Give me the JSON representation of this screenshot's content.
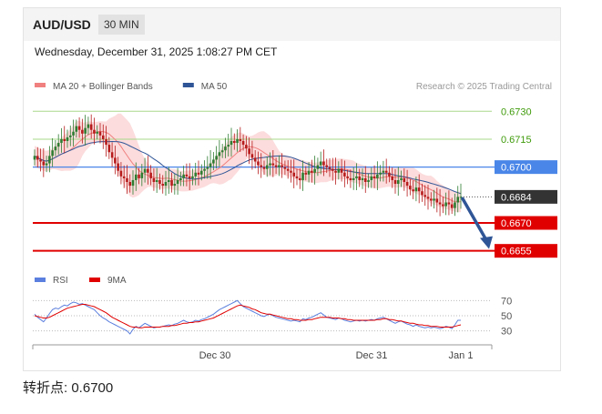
{
  "header": {
    "pair": "AUD/USD",
    "timeframe": "30 MIN",
    "datetime": "Wednesday, December 31, 2025 1:08:27 PM CET"
  },
  "footer": {
    "pivot_label": "转折点:",
    "pivot_value": "0.6700"
  },
  "colors": {
    "ma20": "#f08080",
    "ma50": "#2f5597",
    "bands_fill": "#fbd6d6",
    "pivot_line": "#4a86e8",
    "support_line": "#e00000",
    "resistance_line": "#a9d98a",
    "resistance_text": "#3f9b0b",
    "current_tag": "#333333",
    "arrow": "#2f5597",
    "candle_up": "#2e7d32",
    "candle_down": "#b71c1c",
    "rsi": "#5b7fde",
    "rsi_ma": "#e00000"
  },
  "chart_data": [
    {
      "type": "candlestick",
      "legend": [
        {
          "name": "MA 20 + Bollinger Bands",
          "color": "#f08080"
        },
        {
          "name": "MA 50",
          "color": "#2f5597"
        }
      ],
      "source_note": "Research © 2025 Trading Central",
      "ylim": [
        0.6648,
        0.6736
      ],
      "x_ticks": [
        "Dec 30",
        "Dec 31",
        "Jan 1"
      ],
      "levels": [
        {
          "value": 0.673,
          "label": "0.6730",
          "kind": "resistance"
        },
        {
          "value": 0.6715,
          "label": "0.6715",
          "kind": "resistance"
        },
        {
          "value": 0.67,
          "label": "0.6700",
          "kind": "pivot"
        },
        {
          "value": 0.6684,
          "label": "0.6684",
          "kind": "current"
        },
        {
          "value": 0.667,
          "label": "0.6670",
          "kind": "support"
        },
        {
          "value": 0.6655,
          "label": "0.6655",
          "kind": "support"
        }
      ],
      "close": [
        0.6706,
        0.6704,
        0.6703,
        0.6701,
        0.6702,
        0.6706,
        0.6709,
        0.6711,
        0.6713,
        0.6715,
        0.6714,
        0.6716,
        0.6717,
        0.6719,
        0.6722,
        0.672,
        0.6718,
        0.6721,
        0.6723,
        0.672,
        0.6718,
        0.6719,
        0.6717,
        0.6715,
        0.6712,
        0.6708,
        0.6705,
        0.6702,
        0.6698,
        0.6695,
        0.6694,
        0.6692,
        0.669,
        0.6693,
        0.6696,
        0.6694,
        0.6697,
        0.6699,
        0.6697,
        0.6694,
        0.6692,
        0.6693,
        0.6691,
        0.669,
        0.6692,
        0.6693,
        0.669,
        0.6691,
        0.6693,
        0.6694,
        0.6696,
        0.6695,
        0.6694,
        0.6695,
        0.6697,
        0.6696,
        0.6698,
        0.6699,
        0.67,
        0.6702,
        0.6704,
        0.6706,
        0.6708,
        0.6709,
        0.6711,
        0.6712,
        0.6714,
        0.6713,
        0.6715,
        0.6714,
        0.6712,
        0.671,
        0.6707,
        0.6705,
        0.6703,
        0.6701,
        0.67,
        0.6699,
        0.6701,
        0.6702,
        0.6701,
        0.67,
        0.6701,
        0.67,
        0.6699,
        0.6698,
        0.6697,
        0.6695,
        0.6694,
        0.6693,
        0.6697,
        0.6696,
        0.6698,
        0.6697,
        0.6699,
        0.6701,
        0.6703,
        0.6701,
        0.67,
        0.6699,
        0.6698,
        0.6697,
        0.6699,
        0.6697,
        0.6695,
        0.6694,
        0.6693,
        0.6694,
        0.6695,
        0.6693,
        0.6694,
        0.6692,
        0.6693,
        0.6695,
        0.6694,
        0.6696,
        0.6697,
        0.6698,
        0.6697,
        0.6695,
        0.6693,
        0.6691,
        0.6693,
        0.6694,
        0.6692,
        0.669,
        0.6688,
        0.6687,
        0.6689,
        0.6687,
        0.6685,
        0.6684,
        0.6683,
        0.6682,
        0.6683,
        0.6681,
        0.668,
        0.6679,
        0.6681,
        0.668,
        0.6678,
        0.6681,
        0.6684,
        0.6684
      ],
      "projection": {
        "from": 0.6684,
        "to": 0.6655
      }
    },
    {
      "type": "line",
      "legend": [
        {
          "name": "RSI",
          "color": "#5b7fde"
        },
        {
          "name": "9MA",
          "color": "#e00000"
        }
      ],
      "ylim": [
        20,
        80
      ],
      "y_ticks": [
        70,
        50,
        30
      ],
      "series": [
        {
          "name": "RSI",
          "values": [
            52,
            48,
            45,
            42,
            47,
            53,
            58,
            60,
            59,
            62,
            64,
            63,
            66,
            68,
            67,
            65,
            66,
            64,
            62,
            60,
            58,
            54,
            50,
            47,
            45,
            42,
            40,
            38,
            36,
            34,
            32,
            30,
            26,
            32,
            36,
            34,
            37,
            40,
            38,
            36,
            34,
            35,
            35,
            36,
            37,
            38,
            37,
            39,
            40,
            42,
            44,
            42,
            41,
            42,
            44,
            43,
            45,
            46,
            48,
            50,
            52,
            55,
            58,
            60,
            62,
            64,
            66,
            68,
            70,
            66,
            62,
            60,
            58,
            56,
            54,
            52,
            50,
            49,
            51,
            52,
            50,
            48,
            47,
            46,
            45,
            44,
            43,
            44,
            43,
            42,
            46,
            45,
            47,
            48,
            50,
            52,
            54,
            51,
            48,
            47,
            46,
            45,
            47,
            46,
            44,
            43,
            42,
            43,
            44,
            43,
            44,
            43,
            44,
            45,
            44,
            46,
            47,
            48,
            46,
            44,
            42,
            40,
            42,
            43,
            41,
            39,
            38,
            36,
            38,
            36,
            35,
            34,
            35,
            34,
            35,
            34,
            33,
            34,
            36,
            35,
            33,
            38,
            44,
            44
          ]
        },
        {
          "name": "9MA",
          "values": [
            50,
            49,
            48,
            47,
            47,
            48,
            50,
            52,
            54,
            56,
            58,
            60,
            61,
            62,
            63,
            64,
            65,
            65,
            64,
            63,
            62,
            60,
            58,
            56,
            54,
            51,
            48,
            46,
            44,
            42,
            40,
            38,
            36,
            35,
            35,
            34,
            34,
            35,
            35,
            35,
            35,
            35,
            35,
            36,
            36,
            36,
            37,
            37,
            38,
            39,
            40,
            40,
            41,
            41,
            42,
            42,
            43,
            44,
            45,
            46,
            47,
            49,
            51,
            53,
            55,
            57,
            59,
            61,
            63,
            64,
            63,
            62,
            61,
            59,
            58,
            56,
            54,
            53,
            52,
            52,
            51,
            50,
            49,
            48,
            47,
            46,
            46,
            45,
            45,
            44,
            44,
            44,
            45,
            45,
            46,
            47,
            48,
            48,
            48,
            48,
            47,
            47,
            47,
            46,
            46,
            45,
            45,
            44,
            44,
            44,
            44,
            44,
            44,
            44,
            44,
            45,
            45,
            46,
            46,
            45,
            45,
            44,
            43,
            43,
            42,
            41,
            40,
            40,
            39,
            38,
            38,
            37,
            37,
            36,
            36,
            36,
            35,
            35,
            35,
            35,
            35,
            36,
            37,
            38
          ]
        }
      ]
    }
  ]
}
